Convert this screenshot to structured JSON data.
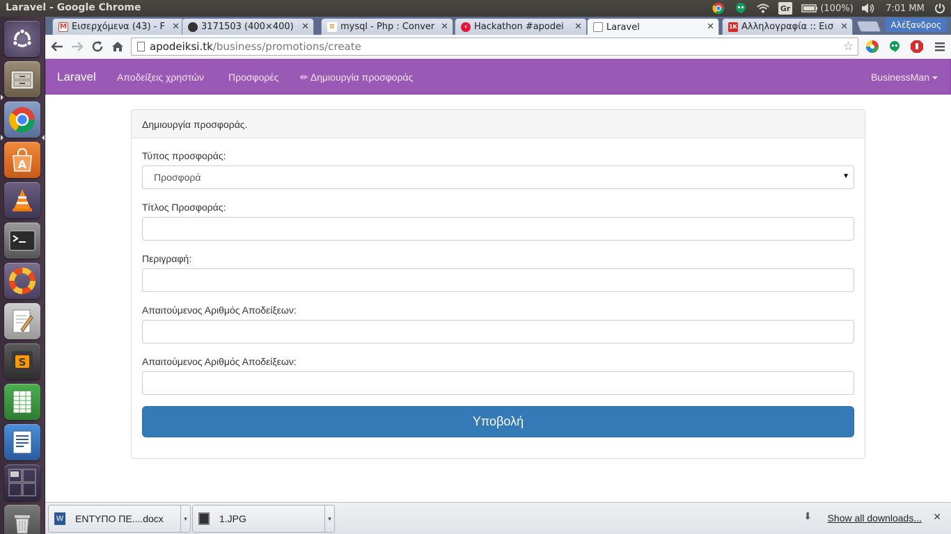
{
  "system": {
    "window_title": "Laravel - Google Chrome",
    "battery": "(100%)",
    "clock": "7:01 MM",
    "gr_indicator": "Gr"
  },
  "tabs": [
    {
      "title": "Εισερχόμενα (43) - F",
      "favicon": "gmail-icon",
      "color": "#d44638"
    },
    {
      "title": "3171503 (400×400)",
      "favicon": "github-icon",
      "color": "#333333"
    },
    {
      "title": "mysql - Php : Conver",
      "favicon": "stackoverflow-icon",
      "color": "#f48024"
    },
    {
      "title": "Hackathon #apodei",
      "favicon": "hackathon-icon",
      "color": "#e0163b"
    },
    {
      "title": "Laravel",
      "favicon": "page-icon",
      "color": "#888888"
    },
    {
      "title": "Αλληλογραφία :: Εισ",
      "favicon": "mail-icon",
      "color": "#d62b2b"
    }
  ],
  "profile_name": "Αλέξανδρος",
  "omnibox": {
    "domain": "apodeiksi.tk",
    "path": "/business/promotions/create"
  },
  "navbar": {
    "brand": "Laravel",
    "links": [
      "Αποδείξεις χρηστών",
      "Προσφορές",
      "✏ Δημιουργία προσφοράς"
    ],
    "user": "BusinessMan",
    "color": "#9b59b6"
  },
  "panel": {
    "heading": "Δημιουργία προσφοράς.",
    "fields": [
      {
        "label": "Τύπος προσφοράς:",
        "type": "select",
        "value": "Προσφορά"
      },
      {
        "label": "Τίτλος Προσφοράς:",
        "type": "text",
        "value": ""
      },
      {
        "label": "Περιγραφή:",
        "type": "text",
        "value": ""
      },
      {
        "label": "Απαιτούμενος Αριθμός Αποδείξεων:",
        "type": "text",
        "value": ""
      },
      {
        "label": "Απαιτούμενος Αριθμός Αποδείξεων:",
        "type": "text",
        "value": ""
      }
    ],
    "submit_label": "Υποβολή",
    "submit_color": "#337ab7"
  },
  "downloads": {
    "items": [
      {
        "name": "ΕΝΤΥΠΟ ΠΕ....docx",
        "icon": "word-doc-icon"
      },
      {
        "name": "1.JPG",
        "icon": "image-file-icon"
      }
    ],
    "show_all": "Show all downloads..."
  }
}
